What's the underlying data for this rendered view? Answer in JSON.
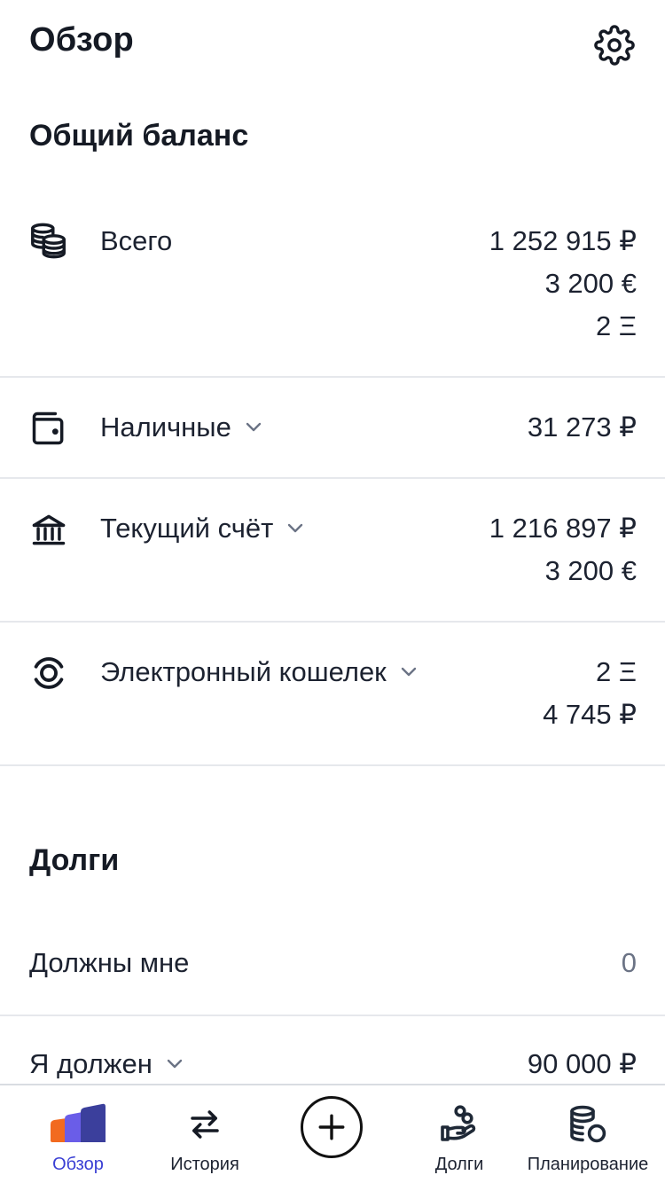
{
  "header": {
    "title": "Обзор",
    "settings_icon": "gear-icon"
  },
  "balance": {
    "title": "Общий баланс",
    "total": {
      "label": "Всего",
      "icon": "coins-stack-icon",
      "amounts": [
        "1 252 915 ₽",
        "3 200 €",
        "2 Ξ"
      ]
    },
    "accounts": [
      {
        "label": "Наличные",
        "icon": "wallet-icon",
        "amounts": [
          "31 273 ₽"
        ]
      },
      {
        "label": "Текущий счёт",
        "icon": "bank-icon",
        "amounts": [
          "1 216 897 ₽",
          "3 200 €"
        ]
      },
      {
        "label": "Электронный кошелек",
        "icon": "e-wallet-icon",
        "amounts": [
          "2 Ξ",
          "4 745 ₽"
        ]
      }
    ]
  },
  "debts": {
    "title": "Долги",
    "owed_to_me": {
      "label": "Должны мне",
      "value": "0"
    },
    "i_owe": {
      "label": "Я должен",
      "value": "90 000 ₽"
    }
  },
  "nav": {
    "items": [
      {
        "label": "Обзор",
        "icon": "overview-chart-icon",
        "active": true
      },
      {
        "label": "История",
        "icon": "swap-arrows-icon",
        "active": false
      },
      {
        "label": "",
        "icon": "plus-circle-icon",
        "active": false
      },
      {
        "label": "Долги",
        "icon": "hand-coins-icon",
        "active": false
      },
      {
        "label": "Планирование",
        "icon": "planning-coins-icon",
        "active": false
      }
    ]
  },
  "colors": {
    "accent": "#3a3fd4",
    "text": "#1c2230",
    "divider": "#e6e8ec",
    "muted": "#6b7385"
  }
}
